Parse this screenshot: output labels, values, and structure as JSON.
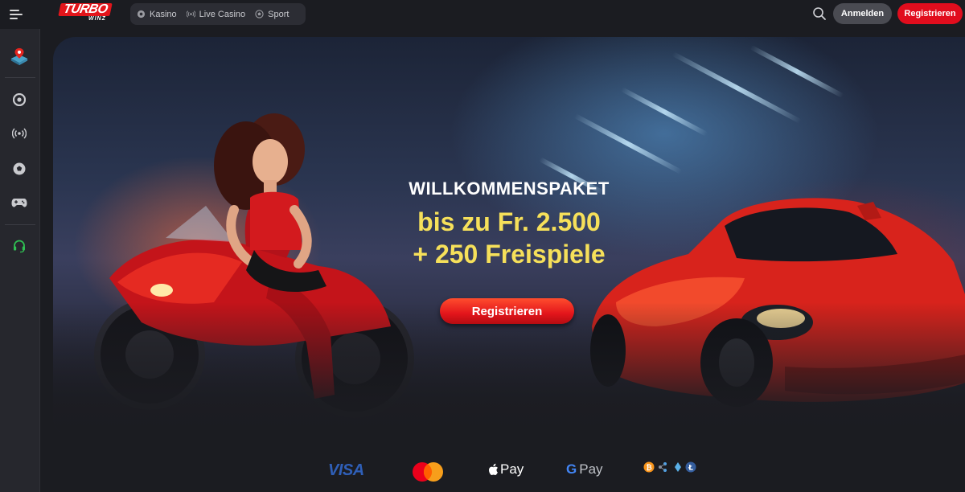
{
  "header": {
    "logo_top": "TURBO",
    "logo_bottom": "WINZ",
    "nav": [
      {
        "label": "Kasino",
        "icon": "chip-icon"
      },
      {
        "label": "Live Casino",
        "icon": "broadcast-icon"
      },
      {
        "label": "Sport",
        "icon": "soccer-ball-icon"
      }
    ],
    "login_label": "Anmelden",
    "register_label": "Registrieren"
  },
  "sidebar": {
    "items": [
      {
        "icon": "map-pin-icon"
      },
      {
        "icon": "chip-icon"
      },
      {
        "icon": "broadcast-icon"
      },
      {
        "icon": "soccer-ball-icon"
      },
      {
        "icon": "gamepad-icon"
      },
      {
        "icon": "headset-support-icon"
      }
    ]
  },
  "hero": {
    "title": "WILLKOMMENSPAKET",
    "amount": "bis zu Fr. 2.500",
    "spins": "+ 250 Freispiele",
    "cta_label": "Registrieren"
  },
  "payments": {
    "visa": "VISA",
    "apple_pay": "Pay",
    "google_pay": "Pay",
    "google_g": "G"
  },
  "colors": {
    "accent_red": "#e10d1d",
    "headline_yellow": "#f6e05a",
    "background": "#1b1c21",
    "sidebar": "#26272d"
  }
}
